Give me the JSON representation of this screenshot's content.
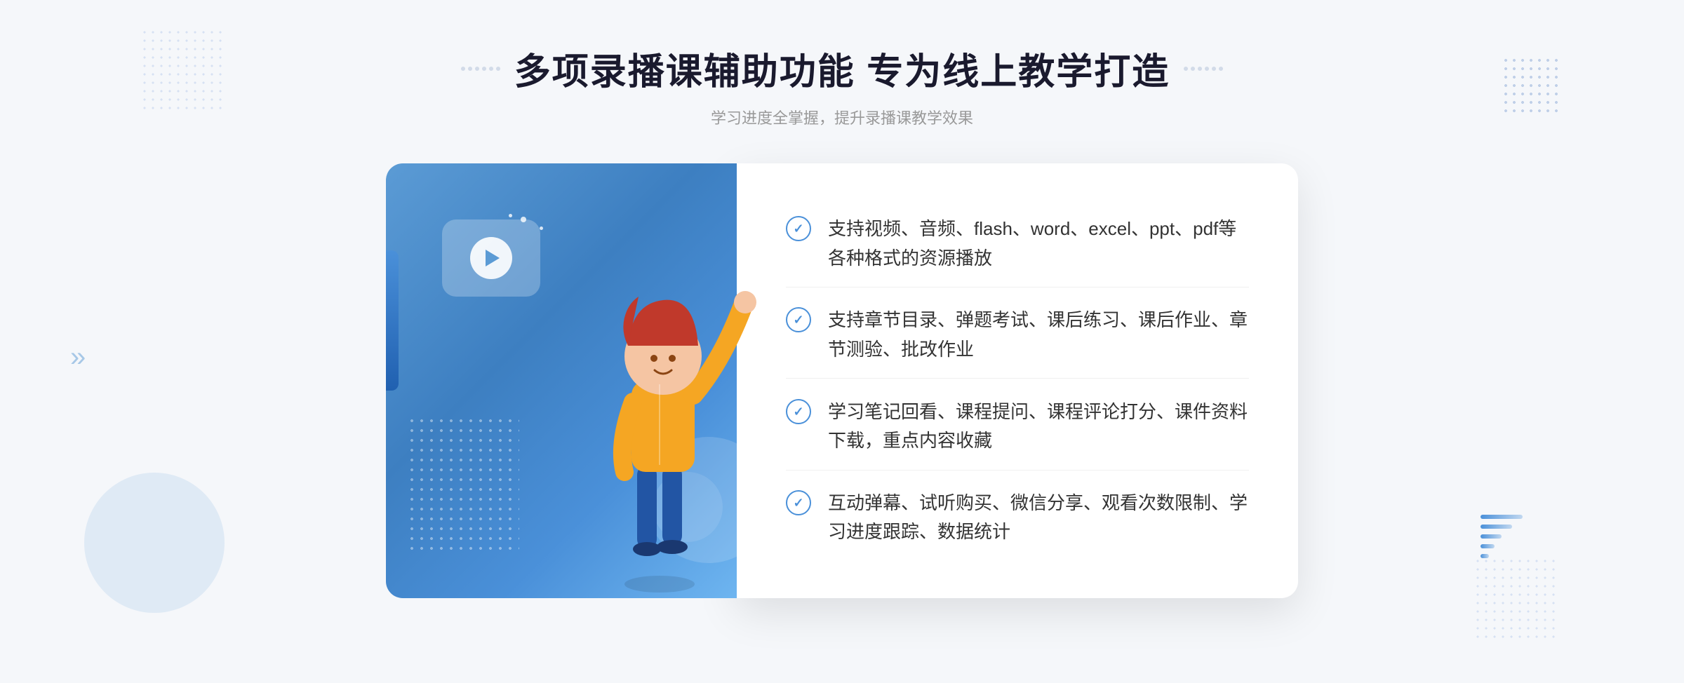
{
  "header": {
    "title": "多项录播课辅助功能 专为线上教学打造",
    "subtitle": "学习进度全掌握，提升录播课教学效果",
    "decoration_left": "❈ ❈",
    "decoration_right": "❈ ❈"
  },
  "features": [
    {
      "id": "feature-1",
      "text": "支持视频、音频、flash、word、excel、ppt、pdf等各种格式的资源播放"
    },
    {
      "id": "feature-2",
      "text": "支持章节目录、弹题考试、课后练习、课后作业、章节测验、批改作业"
    },
    {
      "id": "feature-3",
      "text": "学习笔记回看、课程提问、课程评论打分、课件资料下载，重点内容收藏"
    },
    {
      "id": "feature-4",
      "text": "互动弹幕、试听购买、微信分享、观看次数限制、学习进度跟踪、数据统计"
    }
  ],
  "colors": {
    "primary": "#4a90d9",
    "blue_gradient_start": "#5b9bd5",
    "blue_gradient_end": "#3d7fc1",
    "text_dark": "#1a1a2e",
    "text_gray": "#999999",
    "text_body": "#333333",
    "bg": "#f5f7fa",
    "white": "#ffffff"
  }
}
